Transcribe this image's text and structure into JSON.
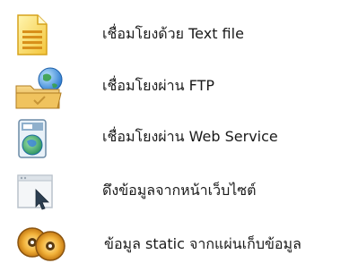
{
  "items": [
    {
      "label": "เชื่อมโยงด้วย Text file",
      "icon": "text-file-icon"
    },
    {
      "label": "เชื่อมโยงผ่าน FTP",
      "icon": "ftp-folder-icon"
    },
    {
      "label": "เชื่อมโยงผ่าน Web Service",
      "icon": "web-service-icon"
    },
    {
      "label": "ดึงข้อมูลจากหน้าเว็บไซต์",
      "icon": "website-cursor-icon"
    },
    {
      "label": "ข้อมูล static จากแผ่นเก็บข้อมูล",
      "icon": "discs-icon"
    }
  ]
}
